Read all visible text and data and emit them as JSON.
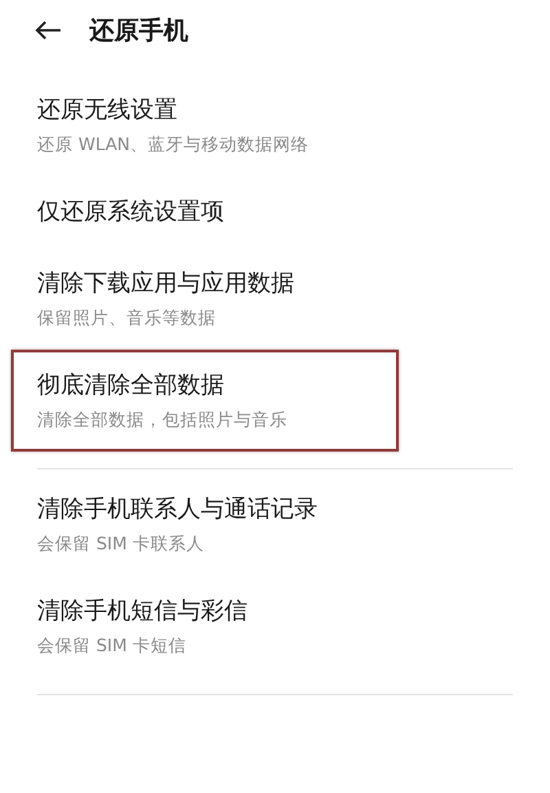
{
  "header": {
    "title": "还原手机"
  },
  "groups": [
    {
      "items": [
        {
          "title": "还原无线设置",
          "subtitle": "还原 WLAN、蓝牙与移动数据网络",
          "highlighted": false
        },
        {
          "title": "仅还原系统设置项",
          "highlighted": false
        },
        {
          "title": "清除下载应用与应用数据",
          "subtitle": "保留照片、音乐等数据",
          "highlighted": false
        },
        {
          "title": "彻底清除全部数据",
          "subtitle": "清除全部数据，包括照片与音乐",
          "highlighted": true
        }
      ]
    },
    {
      "items": [
        {
          "title": "清除手机联系人与通话记录",
          "subtitle": "会保留 SIM 卡联系人",
          "highlighted": false
        },
        {
          "title": "清除手机短信与彩信",
          "subtitle": "会保留 SIM 卡短信",
          "highlighted": false
        }
      ]
    }
  ]
}
